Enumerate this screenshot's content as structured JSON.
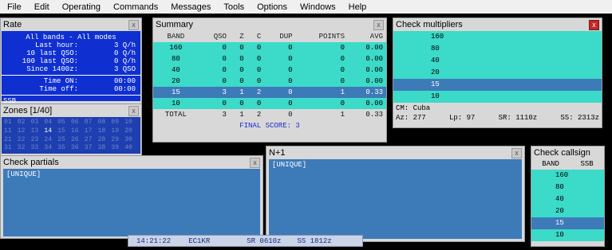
{
  "menu": [
    "File",
    "Edit",
    "Operating",
    "Commands",
    "Messages",
    "Tools",
    "Options",
    "Windows",
    "Help"
  ],
  "rate": {
    "title": "Rate",
    "mode_line": "All bands - All modes",
    "rows": [
      {
        "label": "Last hour:",
        "value": "3 Q/h"
      },
      {
        "label": "10 last QSO:",
        "value": "0 Q/h"
      },
      {
        "label": "100 last QSO:",
        "value": "0 Q/h"
      },
      {
        "label": "Since 1400z:",
        "value": "3 QSO"
      }
    ],
    "time_on_label": "Time ON:",
    "time_on": "00:00",
    "time_off_label": "Time off:",
    "time_off": "00:00",
    "mode": "SSB"
  },
  "zones": {
    "title": "Zones [1/40]",
    "items": [
      "01",
      "02",
      "03",
      "04",
      "05",
      "06",
      "07",
      "08",
      "09",
      "10",
      "11",
      "12",
      "13",
      "14",
      "15",
      "16",
      "17",
      "18",
      "19",
      "20",
      "21",
      "22",
      "23",
      "24",
      "25",
      "26",
      "27",
      "28",
      "29",
      "30",
      "31",
      "32",
      "33",
      "34",
      "35",
      "36",
      "37",
      "38",
      "39",
      "40"
    ],
    "active": "14"
  },
  "summary": {
    "title": "Summary",
    "headers": [
      "BAND",
      "QSO",
      "Z",
      "C",
      "DUP",
      "POINTS",
      "AVG"
    ],
    "rows": [
      [
        "160",
        "0",
        "0",
        "0",
        "0",
        "0",
        "0.00"
      ],
      [
        "80",
        "0",
        "0",
        "0",
        "0",
        "0",
        "0.00"
      ],
      [
        "40",
        "0",
        "0",
        "0",
        "0",
        "0",
        "0.00"
      ],
      [
        "20",
        "0",
        "0",
        "0",
        "0",
        "0",
        "0.00"
      ],
      [
        "15",
        "3",
        "1",
        "2",
        "0",
        "1",
        "0.33"
      ],
      [
        "10",
        "0",
        "0",
        "0",
        "0",
        "0",
        "0.00"
      ]
    ],
    "total": [
      "TOTAL",
      "3",
      "1",
      "2",
      "0",
      "1",
      "0.33"
    ],
    "final": "FINAL SCORE:   3"
  },
  "multipliers": {
    "title": "Check multipliers",
    "bands": [
      "160",
      "80",
      "40",
      "20",
      "15",
      "10"
    ],
    "selected": "15",
    "cm": "CM: Cuba",
    "az": "Az: 277",
    "lp": "Lp:  97",
    "sr": "SR: 1110z",
    "ss": "SS: 2313z"
  },
  "partials": {
    "title": "Check partials",
    "content": "[UNIQUE]"
  },
  "n1": {
    "title": "N+1",
    "content": "[UNIQUE]"
  },
  "callsign": {
    "title": "Check callsign",
    "band_header": "BAND",
    "mode_header": "SSB",
    "bands": [
      "160",
      "80",
      "40",
      "20",
      "15",
      "10"
    ],
    "selected": "15"
  },
  "status": {
    "time": "14:21:22",
    "call": "EC1KR",
    "sr": "SR 0610z",
    "ss": "SS 1812z"
  },
  "close_glyph": "x"
}
